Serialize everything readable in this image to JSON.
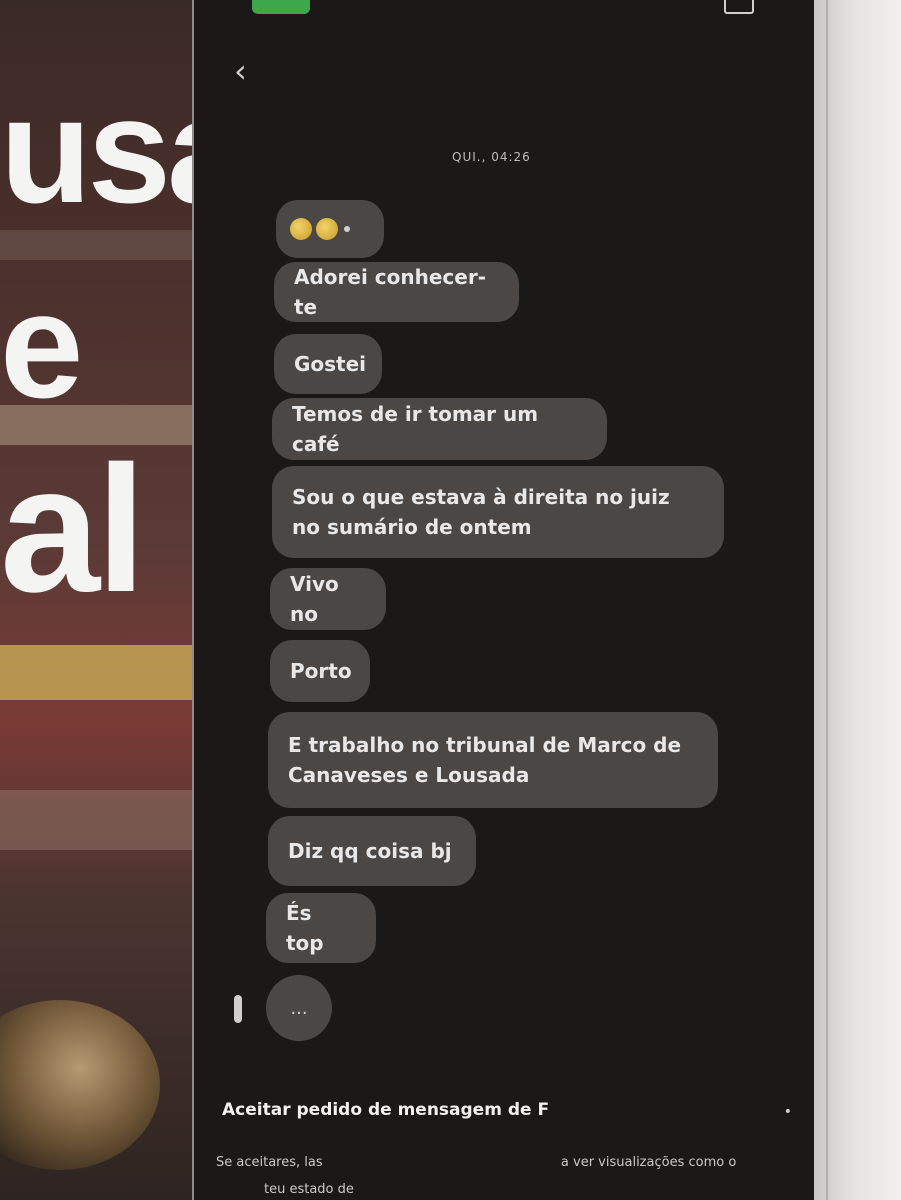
{
  "newspaper": {
    "headline_lines": [
      "usa",
      "e",
      "al"
    ]
  },
  "conversation": {
    "timestamp": "QUI., 04:26",
    "messages": [
      "Adorei conhecer-te",
      "Gostei",
      "Temos de ir tomar um café",
      "Sou o que estava à direita no juiz no sumário de ontem",
      "Vivo no",
      "Porto",
      "E trabalho no tribunal de Marco de Canaveses e Lousada",
      "Diz qq coisa bj",
      "És top"
    ],
    "typing_indicator": "...",
    "emoji_reaction": "emoji-pair"
  },
  "request": {
    "title": "Aceitar pedido de mensagem de F",
    "info_line1": "Se aceitares, las",
    "info_line1_end": "a ver visualizações como o",
    "info_line2": "teu estado de"
  }
}
